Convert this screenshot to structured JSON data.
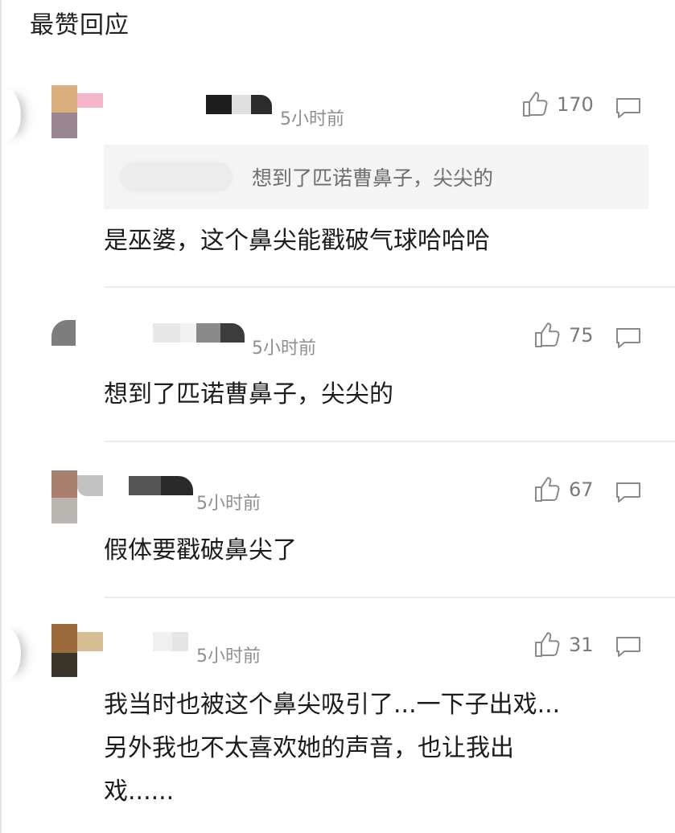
{
  "section_title": "最赞回应",
  "comments": [
    {
      "time": "5小时前",
      "likes": "170",
      "quote": "想到了匹诺曹鼻子，尖尖的",
      "text": "是巫婆，这个鼻尖能戳破气球哈哈哈"
    },
    {
      "time": "5小时前",
      "likes": "75",
      "text": "想到了匹诺曹鼻子，尖尖的"
    },
    {
      "time": "5小时前",
      "likes": "67",
      "text": "假体要戳破鼻尖了"
    },
    {
      "time": "5小时前",
      "likes": "31",
      "text": "我当时也被这个鼻尖吸引了...一下子出戏...\n另外我也不太喜欢她的声音，也让我出\n戏......"
    }
  ],
  "icons": {
    "like": "thumbs-up-icon",
    "reply": "comment-bubble-icon"
  },
  "colors": {
    "background": "#ffffff",
    "meta_text": "#8f8f8f",
    "quote_bg": "#f5f5f5",
    "divider": "#ececec"
  }
}
